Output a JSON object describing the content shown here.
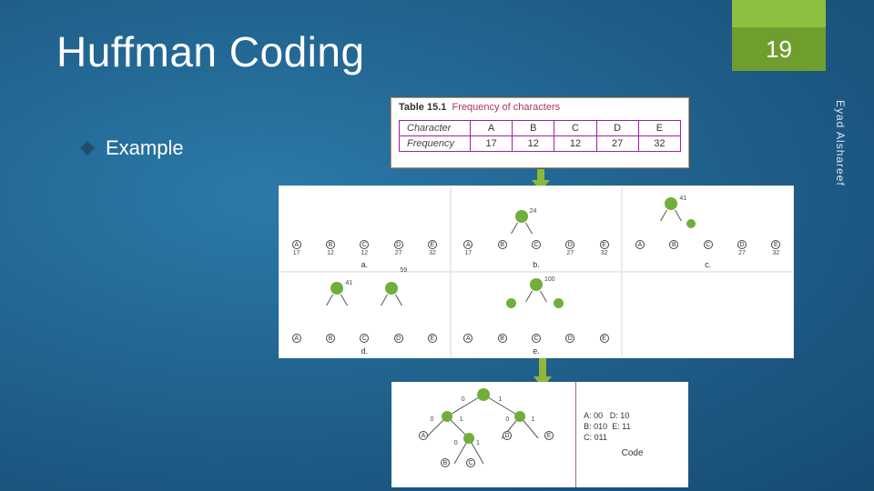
{
  "header": {
    "title": "Huffman Coding",
    "page_number": "19"
  },
  "author": "Eyad Alshareef",
  "bullet": {
    "label": "Example"
  },
  "freq_table": {
    "caption_prefix": "Table 15.1",
    "caption_text": "Frequency of characters",
    "headers": {
      "row1": "Character",
      "row2": "Frequency"
    },
    "cols": [
      "A",
      "B",
      "C",
      "D",
      "E"
    ],
    "values": [
      "17",
      "12",
      "12",
      "27",
      "32"
    ]
  },
  "steps": {
    "a": {
      "label": "a.",
      "leaves": [
        [
          "A",
          "17"
        ],
        [
          "B",
          "12"
        ],
        [
          "C",
          "12"
        ],
        [
          "D",
          "27"
        ],
        [
          "E",
          "32"
        ]
      ]
    },
    "b": {
      "label": "b.",
      "merge_val": "24",
      "leaves": [
        [
          "A",
          "17"
        ],
        [
          "B",
          ""
        ],
        [
          "C",
          ""
        ],
        [
          "D",
          "27"
        ],
        [
          "E",
          "32"
        ]
      ]
    },
    "c": {
      "label": "c.",
      "merge_val": "41",
      "leaves": [
        [
          "A",
          ""
        ],
        [
          "B",
          ""
        ],
        [
          "C",
          ""
        ],
        [
          "D",
          "27"
        ],
        [
          "E",
          "32"
        ]
      ]
    },
    "d": {
      "label": "d.",
      "nodes": [
        "41",
        "59"
      ],
      "leaves": [
        [
          "A",
          ""
        ],
        [
          "B",
          ""
        ],
        [
          "C",
          ""
        ],
        [
          "D",
          ""
        ],
        [
          "E",
          ""
        ]
      ]
    },
    "e": {
      "label": "e.",
      "root": "100",
      "leaves": [
        [
          "A",
          ""
        ],
        [
          "B",
          ""
        ],
        [
          "C",
          ""
        ],
        [
          "D",
          ""
        ],
        [
          "E",
          ""
        ]
      ]
    }
  },
  "final": {
    "edge_labels": [
      "0",
      "1"
    ],
    "leaves": [
      "A",
      "D",
      "E"
    ],
    "sub_leaves": [
      "B",
      "C"
    ],
    "code_title": "Code",
    "codes": [
      {
        "sym": "A",
        "code": "00"
      },
      {
        "sym": "B",
        "code": "010"
      },
      {
        "sym": "C",
        "code": "011"
      },
      {
        "sym": "D",
        "code": "10"
      },
      {
        "sym": "E",
        "code": "11"
      }
    ]
  }
}
